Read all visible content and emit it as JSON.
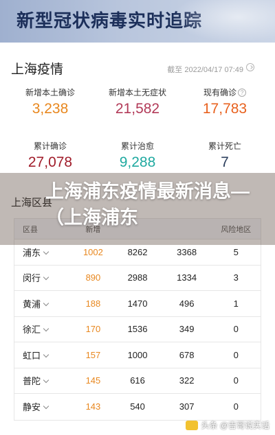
{
  "banner": {
    "title": "新型冠状病毒实时追踪"
  },
  "summary": {
    "title": "上海疫情",
    "timestamp": "截至 2022/04/17 07:49",
    "stats": [
      {
        "label": "新增本土确诊",
        "value": "3,238",
        "color": "#e8871e"
      },
      {
        "label": "新增本土无症状",
        "value": "21,582",
        "color": "#b23a58"
      },
      {
        "label": "现有确诊",
        "value": "17,783",
        "color": "#e8611e"
      },
      {
        "label": "累计确诊",
        "value": "27,078",
        "color": "#a01c2a"
      },
      {
        "label": "累计治愈",
        "value": "9,288",
        "color": "#1fa9a0"
      },
      {
        "label": "累计死亡",
        "value": "7",
        "color": "#2a3d5c"
      }
    ]
  },
  "districts": {
    "title": "上海区县",
    "headers": [
      "区县",
      "新增",
      "",
      "",
      "风险地区"
    ],
    "rows": [
      [
        "浦东",
        "1002",
        "8262",
        "3368",
        "5"
      ],
      [
        "闵行",
        "890",
        "2988",
        "1334",
        "3"
      ],
      [
        "黄浦",
        "188",
        "1470",
        "496",
        "1"
      ],
      [
        "徐汇",
        "170",
        "1536",
        "349",
        "0"
      ],
      [
        "虹口",
        "157",
        "1000",
        "678",
        "0"
      ],
      [
        "普陀",
        "145",
        "616",
        "322",
        "0"
      ],
      [
        "静安",
        "143",
        "540",
        "307",
        "0"
      ]
    ]
  },
  "overlay": {
    "headline": "上海浦东疫情最新消息—（上海浦东"
  },
  "watermark": {
    "text": "头条 @吉哥说实话"
  }
}
